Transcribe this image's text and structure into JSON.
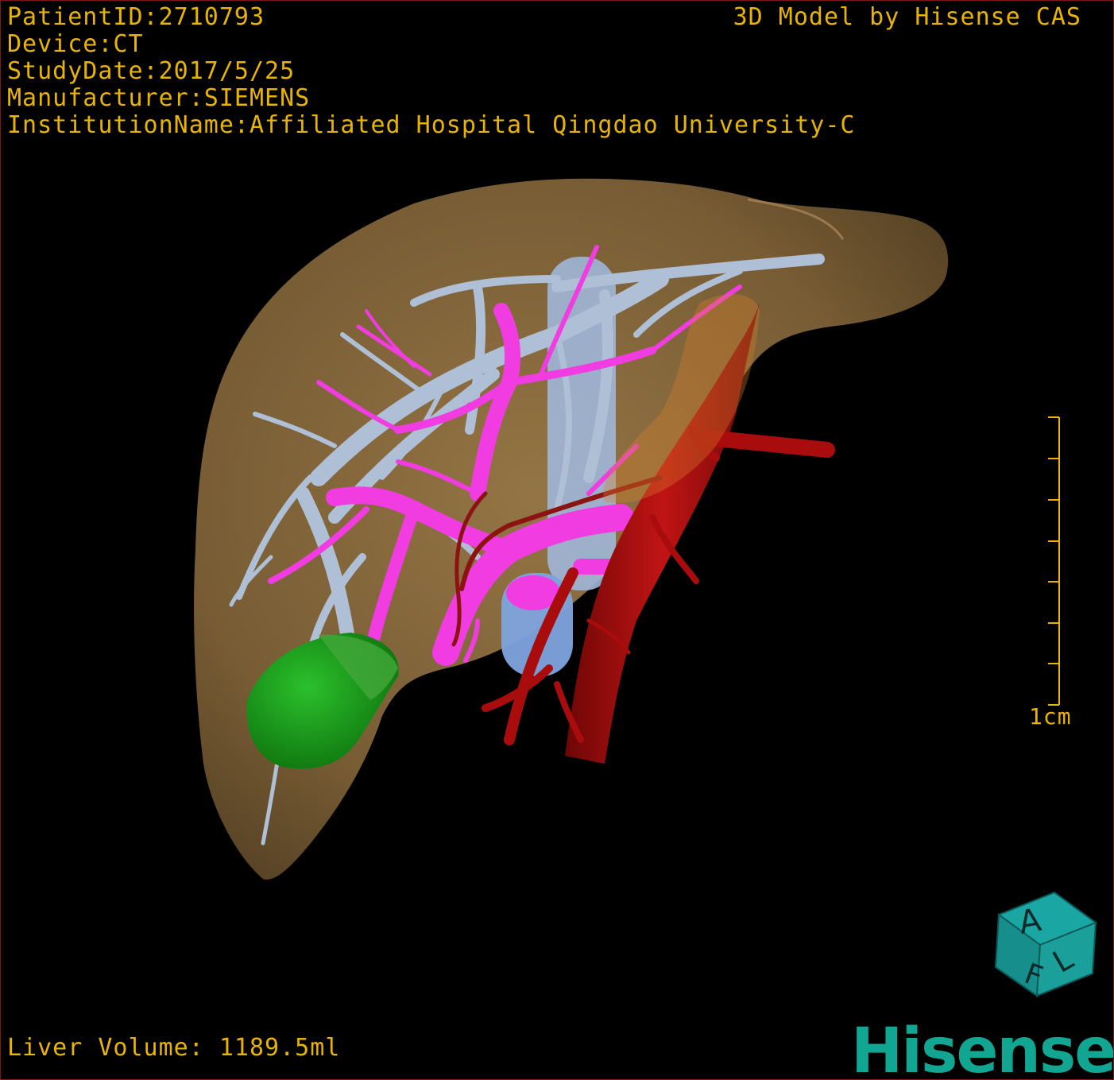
{
  "header": {
    "patient_id": "PatientID:2710793",
    "device": "Device:CT",
    "study_date": "StudyDate:2017/5/25",
    "manufacturer": "Manufacturer:SIEMENS",
    "institution": "InstitutionName:Affiliated Hospital Qingdao University-C",
    "model_credit": "3D Model by Hisense CAS"
  },
  "scale_bar": {
    "label": "1cm"
  },
  "footer": {
    "liver_volume": "Liver Volume: 1189.5ml",
    "logo": "Hisense"
  },
  "orientation_cube": {
    "face_a": "A",
    "face_f": "F",
    "face_l": "L"
  },
  "colors": {
    "overlay_text": "#e8b400",
    "liver": "#8a6a3c",
    "hepatic_vein": "#aebfd6",
    "portal_vein": "#f03ce0",
    "artery": "#a80c0c",
    "tumor": "#18a018",
    "ivc": "#7ea4de",
    "logo": "#11a592"
  }
}
